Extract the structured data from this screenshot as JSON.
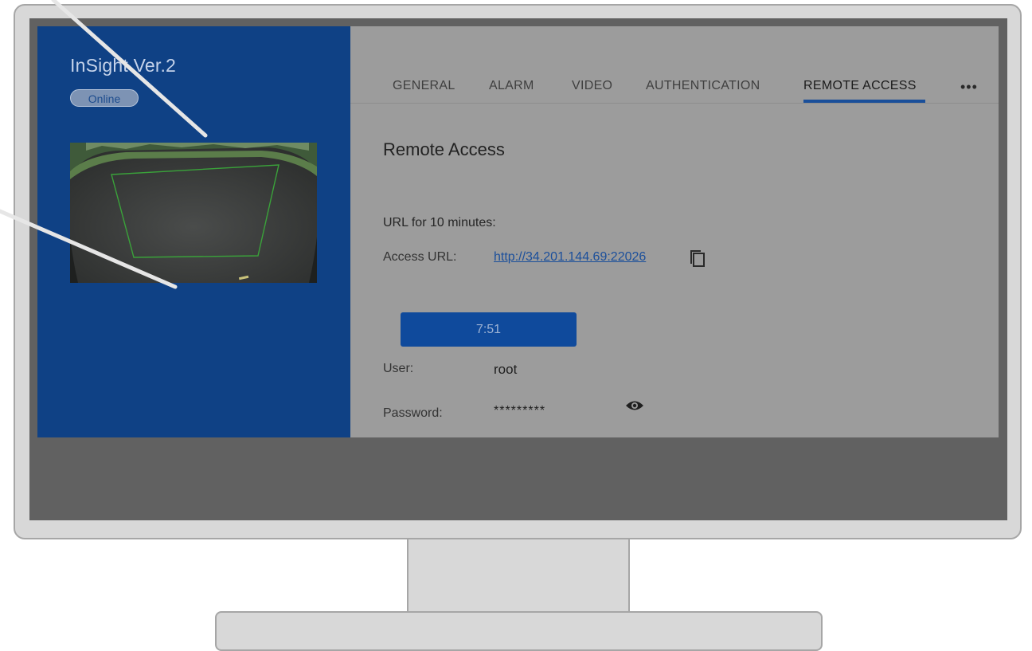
{
  "device": {
    "title": "InSight Ver.2",
    "status": "Online"
  },
  "tabs": [
    {
      "label": "GENERAL",
      "active": false
    },
    {
      "label": "ALARM",
      "active": false
    },
    {
      "label": "VIDEO",
      "active": false
    },
    {
      "label": "AUTHENTICATION",
      "active": false
    },
    {
      "label": "REMOTE ACCESS",
      "active": true
    }
  ],
  "more_icon": "more-horizontal-icon",
  "remote_access": {
    "title": "Remote Access",
    "url_caption": "URL for 10 minutes:",
    "access_url_label": "Access URL:",
    "access_url": "http://34.201.144.69:22026",
    "copy_icon": "copy-icon",
    "timer": "7:51",
    "user_label": "User:",
    "user_value": "root",
    "password_label": "Password:",
    "password_value": "*********",
    "reveal_icon": "eye-icon"
  },
  "colors": {
    "sidebar": "#0f4185",
    "accent": "#1a4f9a",
    "content_bg": "#9c9c9c",
    "screen_bg": "#616161"
  }
}
